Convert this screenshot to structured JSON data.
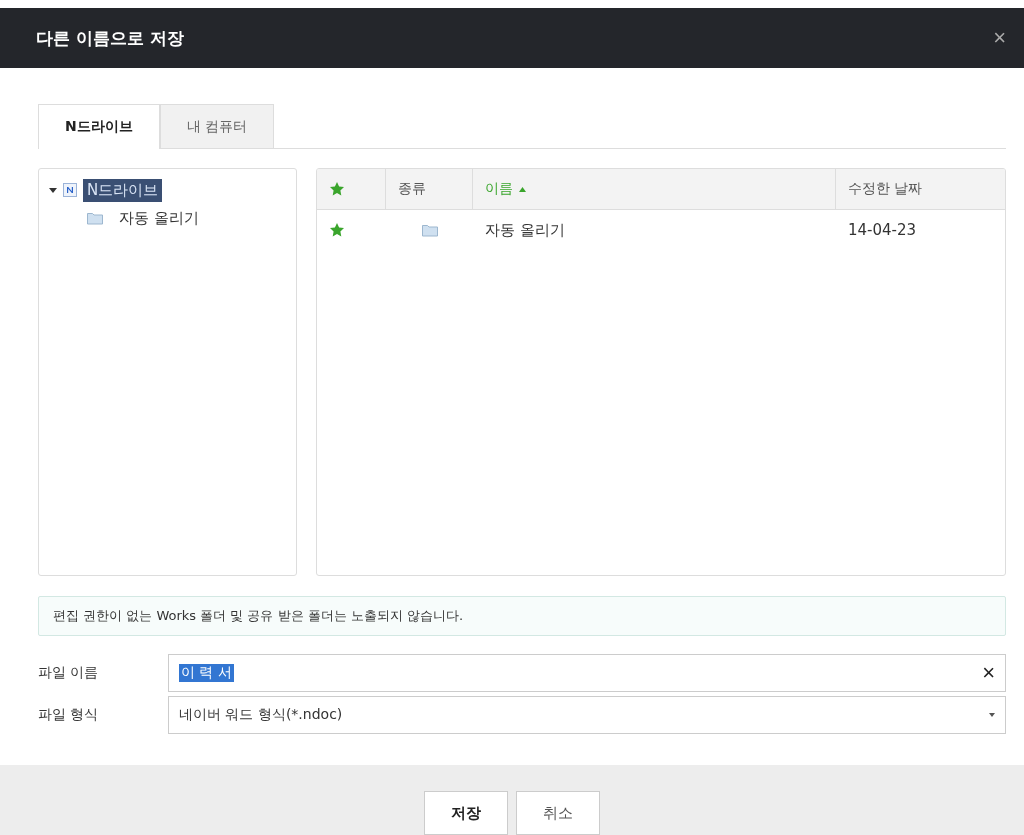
{
  "window": {
    "title": "다른 이름으로 저장",
    "close": "×"
  },
  "tabs": [
    {
      "label": "N드라이브",
      "selected": true
    },
    {
      "label": "내 컴퓨터",
      "selected": false
    }
  ],
  "tree": {
    "root": {
      "label": "N드라이브",
      "selected": true,
      "expanded": true,
      "children": [
        {
          "label": "자동 올리기",
          "selected": false
        }
      ]
    }
  },
  "table": {
    "columns": [
      {
        "kind": "star"
      },
      {
        "kind": "text",
        "label": "종류",
        "sorted": false
      },
      {
        "kind": "text",
        "label": "이름",
        "sorted": true
      },
      {
        "kind": "text",
        "label": "수정한 날짜",
        "sorted": false
      }
    ],
    "rows": [
      {
        "starred": true,
        "name": "자동 올리기",
        "date": "14-04-23",
        "selected": false
      }
    ]
  },
  "notice": "편집 권한이 없는 Works 폴더 및 공유 받은 폴더는 노출되지 않습니다.",
  "file_name": {
    "label": "파일 이름",
    "value": "이 력 서",
    "clear": "×"
  },
  "file_type": {
    "label": "파일 형식",
    "value": "네이버 워드 형식(*.ndoc)"
  },
  "buttons": [
    {
      "label": "저장",
      "primary": true
    },
    {
      "label": "취소",
      "primary": false
    }
  ]
}
